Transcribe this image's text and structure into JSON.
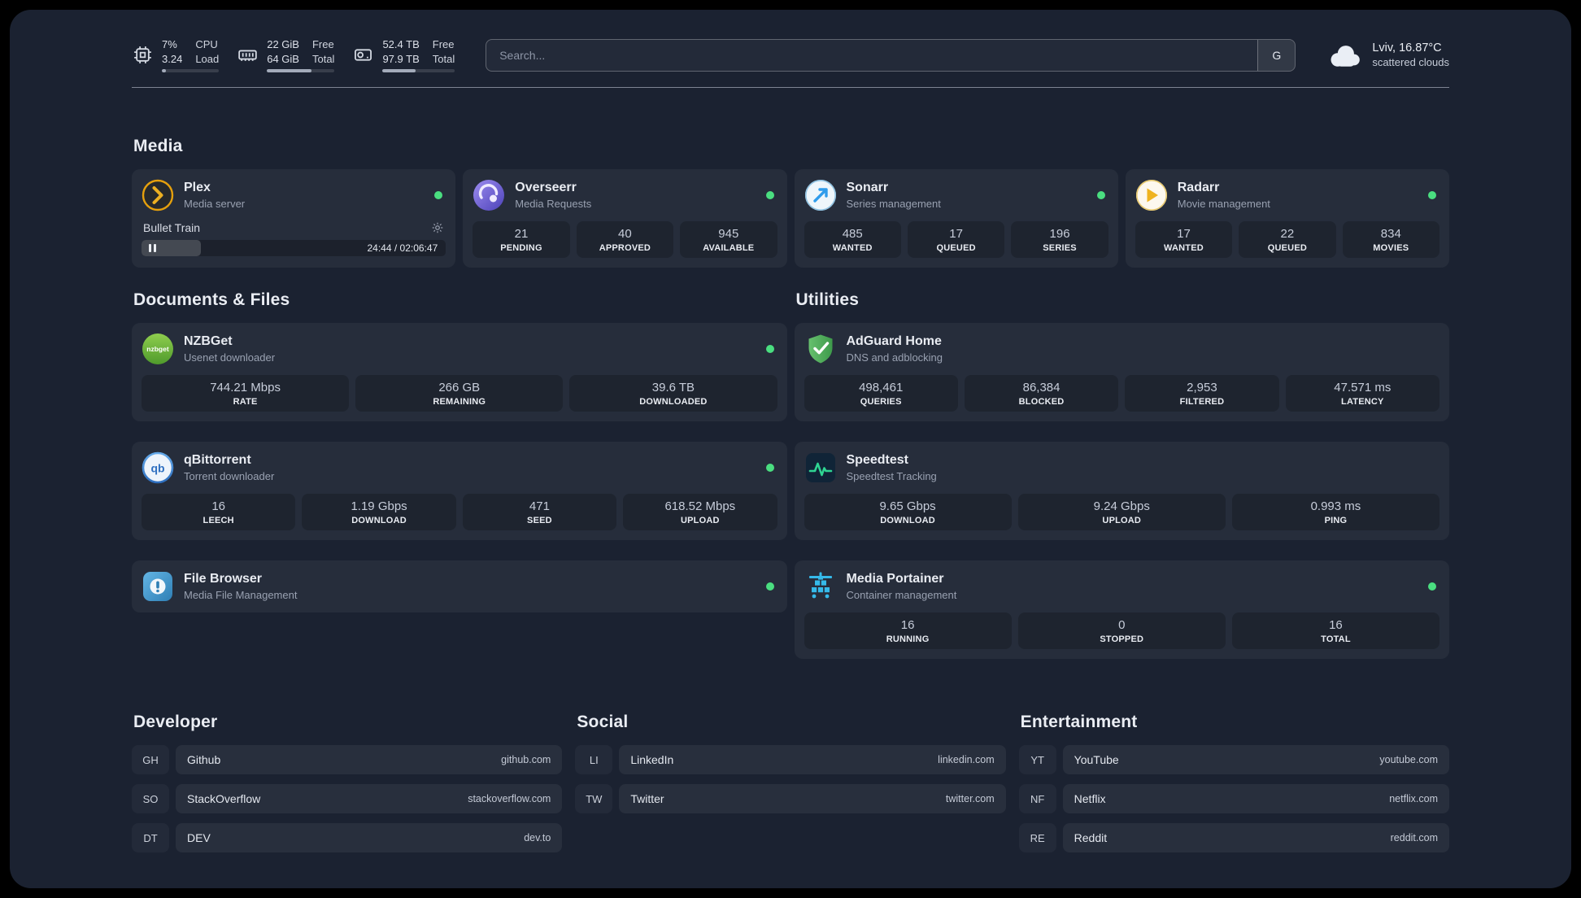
{
  "app": {
    "background": "#1b2231",
    "status_green": "#4ade80"
  },
  "topbar": {
    "resources": [
      {
        "icon": "cpu-icon",
        "value_top": "7%",
        "label_top": "CPU",
        "value_bottom": "3.24",
        "label_bottom": "Load",
        "progress_percent": 7
      },
      {
        "icon": "memory-icon",
        "value_top": "22 GiB",
        "label_top": "Free",
        "value_bottom": "64 GiB",
        "label_bottom": "Total",
        "progress_percent": 66
      },
      {
        "icon": "disk-icon",
        "value_top": "52.4 TB",
        "label_top": "Free",
        "value_bottom": "97.9 TB",
        "label_bottom": "Total",
        "progress_percent": 46
      }
    ],
    "search": {
      "placeholder": "Search...",
      "provider_label": "G"
    },
    "weather": {
      "icon": "cloud-icon",
      "location": "Lviv, 16.87°C",
      "condition": "scattered clouds"
    }
  },
  "sections": {
    "media": {
      "title": "Media",
      "cards": [
        {
          "name": "Plex",
          "subtitle": "Media server",
          "icon": "plex-icon",
          "status": "online",
          "player": {
            "track": "Bullet Train",
            "time": "24:44 / 02:06:47",
            "progress_percent": 19.5
          }
        },
        {
          "name": "Overseerr",
          "subtitle": "Media Requests",
          "icon": "overseerr-icon",
          "status": "online",
          "stats": [
            {
              "value": "21",
              "label": "PENDING"
            },
            {
              "value": "40",
              "label": "APPROVED"
            },
            {
              "value": "945",
              "label": "AVAILABLE"
            }
          ]
        },
        {
          "name": "Sonarr",
          "subtitle": "Series management",
          "icon": "sonarr-icon",
          "status": "online",
          "stats": [
            {
              "value": "485",
              "label": "WANTED"
            },
            {
              "value": "17",
              "label": "QUEUED"
            },
            {
              "value": "196",
              "label": "SERIES"
            }
          ]
        },
        {
          "name": "Radarr",
          "subtitle": "Movie management",
          "icon": "radarr-icon",
          "status": "online",
          "stats": [
            {
              "value": "17",
              "label": "WANTED"
            },
            {
              "value": "22",
              "label": "QUEUED"
            },
            {
              "value": "834",
              "label": "MOVIES"
            }
          ]
        }
      ]
    },
    "documents": {
      "title": "Documents & Files",
      "cards": [
        {
          "name": "NZBGet",
          "subtitle": "Usenet downloader",
          "icon": "nzbget-icon",
          "status": "online",
          "stats": [
            {
              "value": "744.21 Mbps",
              "label": "RATE"
            },
            {
              "value": "266 GB",
              "label": "REMAINING"
            },
            {
              "value": "39.6 TB",
              "label": "DOWNLOADED"
            }
          ]
        },
        {
          "name": "qBittorrent",
          "subtitle": "Torrent downloader",
          "icon": "qbittorrent-icon",
          "status": "online",
          "stats": [
            {
              "value": "16",
              "label": "LEECH"
            },
            {
              "value": "1.19 Gbps",
              "label": "DOWNLOAD"
            },
            {
              "value": "471",
              "label": "SEED"
            },
            {
              "value": "618.52 Mbps",
              "label": "UPLOAD"
            }
          ]
        },
        {
          "name": "File Browser",
          "subtitle": "Media File Management",
          "icon": "filebrowser-icon",
          "status": "online"
        }
      ]
    },
    "utilities": {
      "title": "Utilities",
      "cards": [
        {
          "name": "AdGuard Home",
          "subtitle": "DNS and adblocking",
          "icon": "adguard-icon",
          "stats": [
            {
              "value": "498,461",
              "label": "QUERIES"
            },
            {
              "value": "86,384",
              "label": "BLOCKED"
            },
            {
              "value": "2,953",
              "label": "FILTERED"
            },
            {
              "value": "47.571 ms",
              "label": "LATENCY"
            }
          ]
        },
        {
          "name": "Speedtest",
          "subtitle": "Speedtest Tracking",
          "icon": "speedtest-icon",
          "stats": [
            {
              "value": "9.65 Gbps",
              "label": "DOWNLOAD"
            },
            {
              "value": "9.24 Gbps",
              "label": "UPLOAD"
            },
            {
              "value": "0.993 ms",
              "label": "PING"
            }
          ]
        },
        {
          "name": "Media Portainer",
          "subtitle": "Container management",
          "icon": "portainer-icon",
          "status": "online",
          "stats": [
            {
              "value": "16",
              "label": "RUNNING"
            },
            {
              "value": "0",
              "label": "STOPPED"
            },
            {
              "value": "16",
              "label": "TOTAL"
            }
          ]
        }
      ]
    }
  },
  "bookmarks": [
    {
      "title": "Developer",
      "links": [
        {
          "abbr": "GH",
          "name": "Github",
          "domain": "github.com"
        },
        {
          "abbr": "SO",
          "name": "StackOverflow",
          "domain": "stackoverflow.com"
        },
        {
          "abbr": "DT",
          "name": "DEV",
          "domain": "dev.to"
        }
      ]
    },
    {
      "title": "Social",
      "links": [
        {
          "abbr": "LI",
          "name": "LinkedIn",
          "domain": "linkedin.com"
        },
        {
          "abbr": "TW",
          "name": "Twitter",
          "domain": "twitter.com"
        }
      ]
    },
    {
      "title": "Entertainment",
      "links": [
        {
          "abbr": "YT",
          "name": "YouTube",
          "domain": "youtube.com"
        },
        {
          "abbr": "NF",
          "name": "Netflix",
          "domain": "netflix.com"
        },
        {
          "abbr": "RE",
          "name": "Reddit",
          "domain": "reddit.com"
        }
      ]
    }
  ]
}
